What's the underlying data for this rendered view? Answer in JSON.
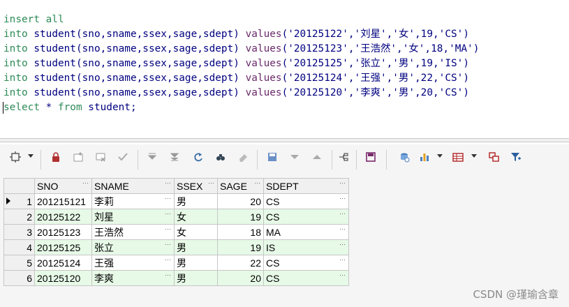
{
  "editor": {
    "line0": "insert all",
    "insert_rows": [
      {
        "kw": "into",
        "table": "student(sno,sname,ssex,sage,sdept)",
        "values_kw": "values",
        "args": "('20125122','刘星','女',19,'CS')"
      },
      {
        "kw": "into",
        "table": "student(sno,sname,ssex,sage,sdept)",
        "values_kw": "values",
        "args": "('20125123','王浩然','女',18,'MA')"
      },
      {
        "kw": "into",
        "table": "student(sno,sname,ssex,sage,sdept)",
        "values_kw": "values",
        "args": "('20125125','张立','男',19,'IS')"
      },
      {
        "kw": "into",
        "table": "student(sno,sname,ssex,sage,sdept)",
        "values_kw": "values",
        "args": "('20125124','王强','男',22,'CS')"
      },
      {
        "kw": "into",
        "table": "student(sno,sname,ssex,sage,sdept)",
        "values_kw": "values",
        "args": "('20125120','李爽','男',20,'CS')"
      }
    ],
    "select_kw": "select",
    "select_mid": " * ",
    "from_kw": "from",
    "select_table": " student;"
  },
  "toolbar": {
    "icons": [
      "grid-icon",
      "lock-icon",
      "new-record-icon",
      "delete-record-icon",
      "post-icon",
      "first-icon",
      "last-icon",
      "refresh-icon",
      "find-icon",
      "clear-icon",
      "save-icon",
      "filter-down-icon",
      "filter-up-icon",
      "export-icon",
      "save-disk-icon",
      "connect-icon",
      "chart-icon",
      "table-view-icon",
      "pivot-icon",
      "filter-icon"
    ]
  },
  "grid": {
    "columns": [
      "SNO",
      "SNAME",
      "SSEX",
      "SAGE",
      "SDEPT"
    ],
    "rows": [
      {
        "num": "1",
        "sno": "201215121",
        "sname": "李莉",
        "ssex": "男",
        "sage": "20",
        "sdept": "CS"
      },
      {
        "num": "2",
        "sno": "20125122",
        "sname": "刘星",
        "ssex": "女",
        "sage": "19",
        "sdept": "CS"
      },
      {
        "num": "3",
        "sno": "20125123",
        "sname": "王浩然",
        "ssex": "女",
        "sage": "18",
        "sdept": "MA"
      },
      {
        "num": "4",
        "sno": "20125125",
        "sname": "张立",
        "ssex": "男",
        "sage": "19",
        "sdept": "IS"
      },
      {
        "num": "5",
        "sno": "20125124",
        "sname": "王强",
        "ssex": "男",
        "sage": "22",
        "sdept": "CS"
      },
      {
        "num": "6",
        "sno": "20125120",
        "sname": "李爽",
        "ssex": "男",
        "sage": "20",
        "sdept": "CS"
      }
    ],
    "ellipsis": "···",
    "selected_row": 1
  },
  "watermark": "CSDN @瑾瑜含章",
  "colors": {
    "keyword": "#2e8b57",
    "identifier": "#000080",
    "alt_row": "#e7f9e7"
  }
}
